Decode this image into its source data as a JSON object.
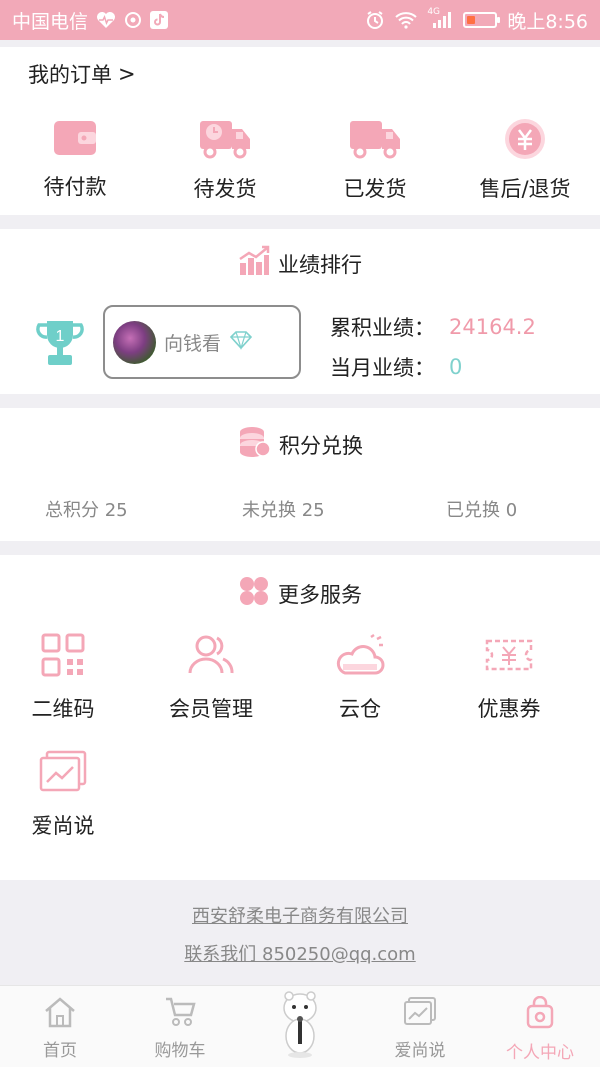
{
  "status_bar": {
    "carrier": "中国电信",
    "network": "4G",
    "time": "晚上8:56",
    "battery_level": 0.3,
    "battery_color": "#ff7043"
  },
  "orders": {
    "title": "我的订单",
    "chevron": ">",
    "items": [
      {
        "label": "待付款",
        "icon": "wallet-icon"
      },
      {
        "label": "待发货",
        "icon": "truck-clock-icon"
      },
      {
        "label": "已发货",
        "icon": "truck-icon"
      },
      {
        "label": "售后/退货",
        "icon": "yuan-refund-icon"
      }
    ]
  },
  "performance": {
    "title": "业绩排行",
    "rank": "1",
    "user_name": "向钱看",
    "cumulative_label": "累积业绩：",
    "cumulative_value": "24164.2",
    "monthly_label": "当月业绩：",
    "monthly_value": "0"
  },
  "points": {
    "title": "积分兑换",
    "total": "总积分 25",
    "unredeemed": "未兑换 25",
    "redeemed": "已兑换 0"
  },
  "services": {
    "title": "更多服务",
    "items": [
      {
        "label": "二维码",
        "icon": "qr-code-icon"
      },
      {
        "label": "会员管理",
        "icon": "members-icon"
      },
      {
        "label": "云仓",
        "icon": "cloud-warehouse-icon"
      },
      {
        "label": "优惠券",
        "icon": "coupon-icon"
      },
      {
        "label": "爱尚说",
        "icon": "chart-icon"
      }
    ]
  },
  "footer": {
    "company": "西安舒柔电子商务有限公司",
    "contact": "联系我们 850250@qq.com"
  },
  "tabs": [
    {
      "label": "首页",
      "icon": "home-icon"
    },
    {
      "label": "购物车",
      "icon": "cart-icon"
    },
    {
      "label": "",
      "icon": "mascot-icon"
    },
    {
      "label": "爱尚说",
      "icon": "chart-icon"
    },
    {
      "label": "个人中心",
      "icon": "bag-icon"
    }
  ],
  "colors": {
    "accent": "#f4a7b7",
    "teal": "#7fd1cd",
    "status_bar": "#f2a9b8"
  }
}
